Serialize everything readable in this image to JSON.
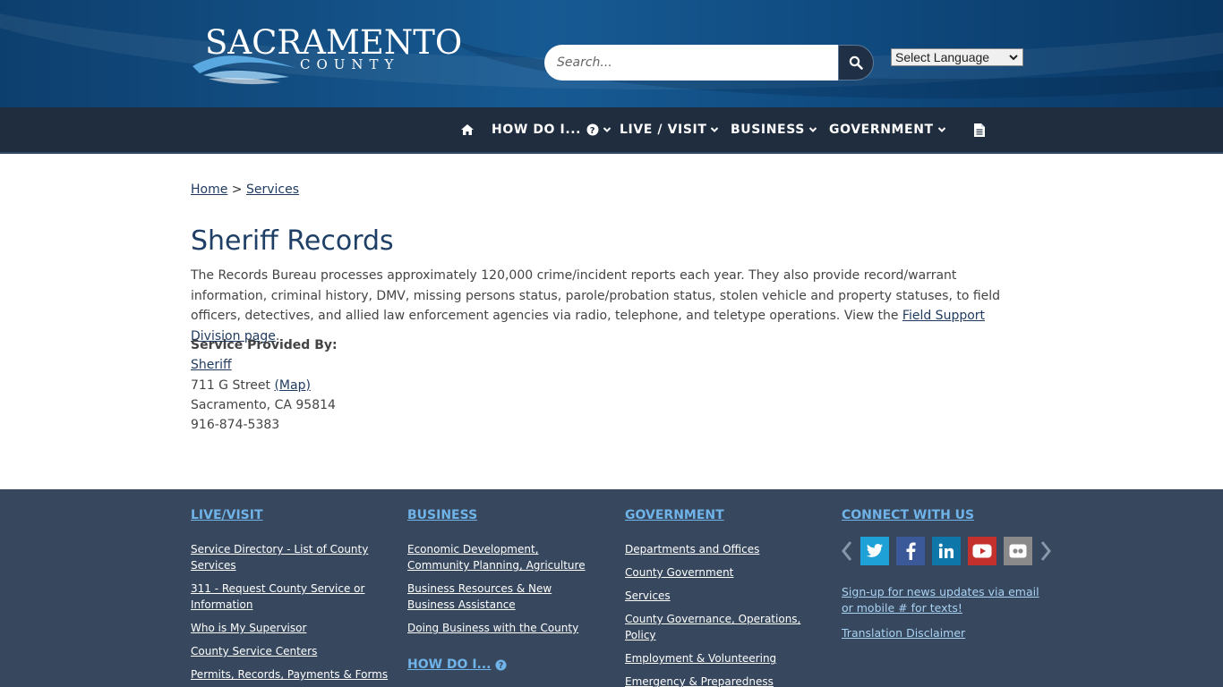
{
  "header": {
    "logo_title": "SACRAMENTO",
    "logo_subtitle": "COUNTY",
    "search_placeholder": "Search...",
    "language_label": "Select Language"
  },
  "nav": {
    "items": [
      {
        "label": "HOW DO I..."
      },
      {
        "label": "LIVE / VISIT"
      },
      {
        "label": "BUSINESS"
      },
      {
        "label": "GOVERNMENT"
      }
    ]
  },
  "breadcrumb": {
    "home": "Home",
    "separator": ">",
    "current": "Services"
  },
  "page": {
    "title": "Sheriff Records",
    "description_pre": "The Records Bureau processes approximately 120,000 crime/incident reports each year. They also provide record/warrant information, criminal history, DMV, missing persons status, parole/probation status, stolen vehicle and property statuses, to field officers, detectives, and allied law enforcement agencies via radio, telephone, and teletype operations. View the ",
    "description_link": "Field Support Division page",
    "description_post": ".",
    "provider_label": "Service Provided By:",
    "provider_name": "Sheriff",
    "street": "711 G Street",
    "map_link": "(Map)",
    "city": "Sacramento, CA 95814",
    "phone": "916-874-5383"
  },
  "footer": {
    "live_visit": {
      "heading": "LIVE/VISIT",
      "links": [
        "Service Directory - List of County Services",
        "311 - Request County Service or Information",
        "Who is My Supervisor",
        "County Service Centers",
        "Permits, Records, Payments & Forms"
      ]
    },
    "business": {
      "heading": "BUSINESS",
      "links": [
        "Economic Development, Community Planning, Agriculture",
        "Business Resources & New Business Assistance",
        "Doing Business with the County"
      ],
      "how_do_i": "HOW DO I..."
    },
    "government": {
      "heading": "GOVERNMENT",
      "links": [
        "Departments and Offices",
        "County Government",
        "Services",
        "County Governance, Operations, Policy",
        "Employment & Volunteering",
        "Emergency & Preparedness"
      ]
    },
    "connect": {
      "heading": "CONNECT WITH US",
      "signup": "Sign-up for news updates via email or mobile # for texts!",
      "disclaimer": "Translation Disclaimer",
      "social_colors": {
        "twitter": "#1da1d6",
        "facebook": "#3b5998",
        "linkedin": "#0e76a8",
        "youtube": "#c4302b",
        "flickr": "#8a8a8a"
      }
    }
  }
}
